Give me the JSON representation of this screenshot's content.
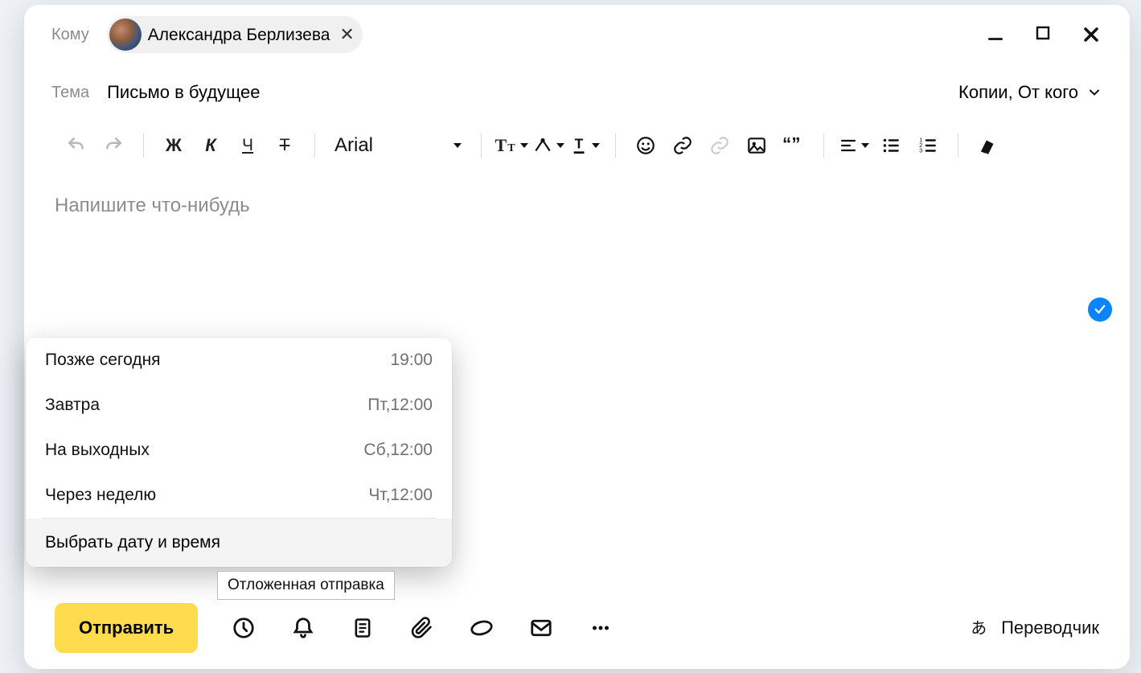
{
  "to": {
    "label": "Кому",
    "recipient_name": "Александра Берлизева"
  },
  "subject": {
    "label": "Тема",
    "value": "Письмо в будущее"
  },
  "copies_label": "Копии, От кого",
  "toolbar": {
    "bold": "Ж",
    "italic": "К",
    "underline": "Ч",
    "strike": "Т",
    "font": "Arial"
  },
  "editor_placeholder": "Напишите что-нибудь",
  "schedule": {
    "items": [
      {
        "label": "Позже сегодня",
        "time": "19:00"
      },
      {
        "label": "Завтра",
        "time": "Пт,12:00"
      },
      {
        "label": "На выходных",
        "time": "Сб,12:00"
      },
      {
        "label": "Через неделю",
        "time": "Чт,12:00"
      }
    ],
    "custom": "Выбрать дату и время"
  },
  "tooltip_schedule": "Отложенная отправка",
  "send_button": "Отправить",
  "translator_label": "Переводчик"
}
